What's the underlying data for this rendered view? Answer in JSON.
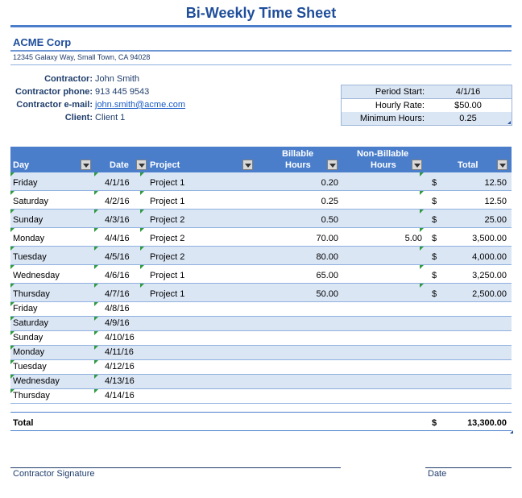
{
  "title": "Bi-Weekly Time Sheet",
  "company": {
    "name": "ACME Corp",
    "address": "12345 Galaxy Way, Small Town, CA 94028"
  },
  "contractor": {
    "name_label": "Contractor:",
    "name": "John Smith",
    "phone_label": "Contractor phone:",
    "phone": "913 445 9543",
    "email_label": "Contractor e-mail:",
    "email": "john.smith@acme.com",
    "client_label": "Client:",
    "client": "Client 1"
  },
  "period": {
    "start_label": "Period Start:",
    "start": "4/1/16",
    "rate_label": "Hourly Rate:",
    "rate": "$50.00",
    "min_label": "Minimum Hours:",
    "min": "0.25"
  },
  "table": {
    "headers": {
      "day": "Day",
      "date": "Date",
      "project": "Project",
      "billable_1": "Billable",
      "billable_2": "Hours",
      "nonbillable_1": "Non-Billable",
      "nonbillable_2": "Hours",
      "total": "Total"
    },
    "rows": [
      {
        "day": "Friday",
        "date": "4/1/16",
        "project": "Project 1",
        "billable": "0.20",
        "nonbillable": "",
        "currency": "$",
        "total": "12.50"
      },
      {
        "day": "Saturday",
        "date": "4/2/16",
        "project": "Project 1",
        "billable": "0.25",
        "nonbillable": "",
        "currency": "$",
        "total": "12.50"
      },
      {
        "day": "Sunday",
        "date": "4/3/16",
        "project": "Project 2",
        "billable": "0.50",
        "nonbillable": "",
        "currency": "$",
        "total": "25.00"
      },
      {
        "day": "Monday",
        "date": "4/4/16",
        "project": "Project 2",
        "billable": "70.00",
        "nonbillable": "5.00",
        "currency": "$",
        "total": "3,500.00"
      },
      {
        "day": "Tuesday",
        "date": "4/5/16",
        "project": "Project 2",
        "billable": "80.00",
        "nonbillable": "",
        "currency": "$",
        "total": "4,000.00"
      },
      {
        "day": "Wednesday",
        "date": "4/6/16",
        "project": "Project 1",
        "billable": "65.00",
        "nonbillable": "",
        "currency": "$",
        "total": "3,250.00"
      },
      {
        "day": "Thursday",
        "date": "4/7/16",
        "project": "Project 1",
        "billable": "50.00",
        "nonbillable": "",
        "currency": "$",
        "total": "2,500.00"
      },
      {
        "day": "Friday",
        "date": "4/8/16",
        "project": "",
        "billable": "",
        "nonbillable": "",
        "currency": "",
        "total": ""
      },
      {
        "day": "Saturday",
        "date": "4/9/16",
        "project": "",
        "billable": "",
        "nonbillable": "",
        "currency": "",
        "total": ""
      },
      {
        "day": "Sunday",
        "date": "4/10/16",
        "project": "",
        "billable": "",
        "nonbillable": "",
        "currency": "",
        "total": ""
      },
      {
        "day": "Monday",
        "date": "4/11/16",
        "project": "",
        "billable": "",
        "nonbillable": "",
        "currency": "",
        "total": ""
      },
      {
        "day": "Tuesday",
        "date": "4/12/16",
        "project": "",
        "billable": "",
        "nonbillable": "",
        "currency": "",
        "total": ""
      },
      {
        "day": "Wednesday",
        "date": "4/13/16",
        "project": "",
        "billable": "",
        "nonbillable": "",
        "currency": "",
        "total": ""
      },
      {
        "day": "Thursday",
        "date": "4/14/16",
        "project": "",
        "billable": "",
        "nonbillable": "",
        "currency": "",
        "total": ""
      }
    ],
    "total_label": "Total",
    "total_currency": "$",
    "total_value": "13,300.00"
  },
  "signature": {
    "contractor_label": "Contractor Signature",
    "date_label": "Date"
  },
  "colors": {
    "header_blue": "#4a7ecb",
    "row_shade": "#dbe6f5",
    "title_blue": "#1f4e9b"
  }
}
